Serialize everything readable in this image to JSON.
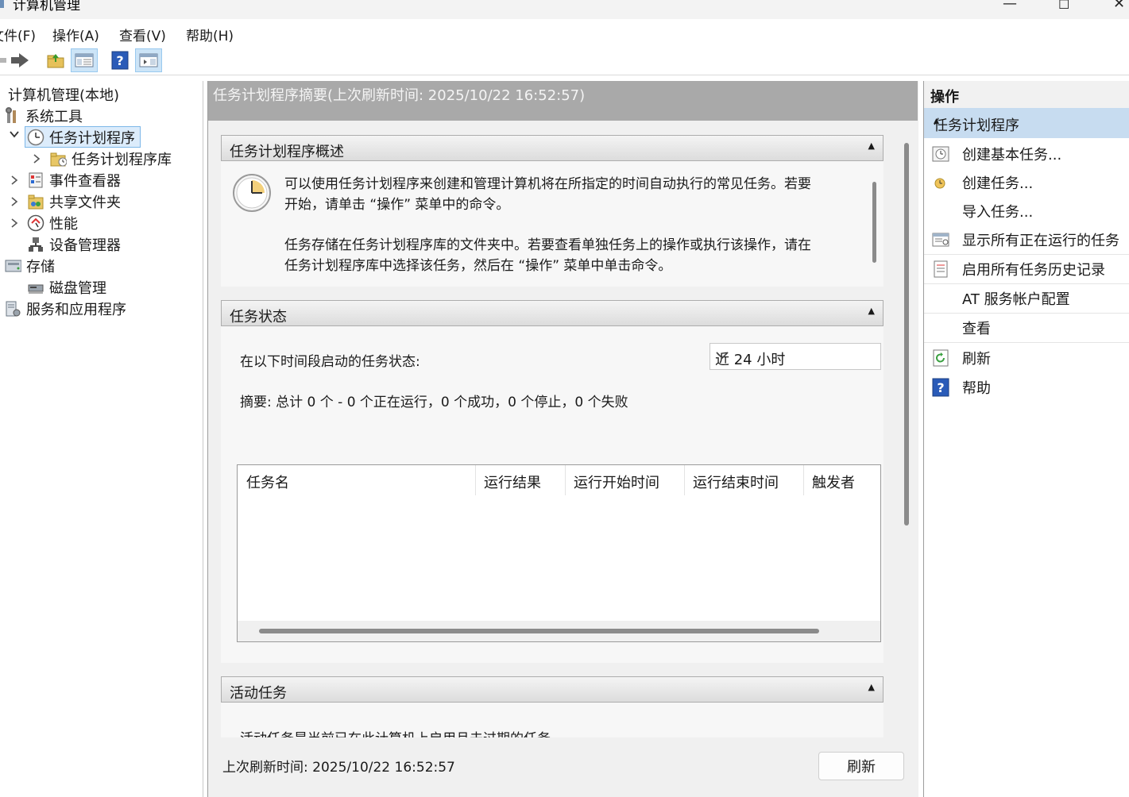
{
  "window": {
    "title": "计算机管理",
    "controls": {
      "minimize": "—",
      "maximize": "☐",
      "close": "✕"
    }
  },
  "menu": {
    "items": [
      "文件(F)",
      "操作(A)",
      "查看(V)",
      "帮助(H)"
    ]
  },
  "toolbar": {
    "buttons": [
      "back-arrow-icon",
      "forward-arrow-icon",
      "up-folder-icon",
      "show-hide-console-tree-icon",
      "help-icon",
      "show-hide-action-pane-icon"
    ]
  },
  "tree": {
    "items": [
      {
        "label": "计算机管理(本地)",
        "icon": "computer-icon"
      },
      {
        "label": "系统工具",
        "icon": "tools-icon"
      },
      {
        "label": "任务计划程序",
        "icon": "clock-icon",
        "selected": true
      },
      {
        "label": "任务计划程序库",
        "icon": "folder-clock-icon"
      },
      {
        "label": "事件查看器",
        "icon": "event-viewer-icon"
      },
      {
        "label": "共享文件夹",
        "icon": "shared-folder-icon"
      },
      {
        "label": "性能",
        "icon": "performance-icon"
      },
      {
        "label": "设备管理器",
        "icon": "device-manager-icon"
      },
      {
        "label": "存储",
        "icon": "storage-icon"
      },
      {
        "label": "磁盘管理",
        "icon": "disk-icon"
      },
      {
        "label": "服务和应用程序",
        "icon": "services-icon"
      }
    ]
  },
  "center": {
    "header": "任务计划程序摘要(上次刷新时间: 2025/10/22 16:52:57)",
    "overview": {
      "title": "任务计划程序概述",
      "para1_line1": "可以使用任务计划程序来创建和管理计算机将在所指定的时间自动执行的常见任务。若要",
      "para1_line2": "开始，请单击 “操作” 菜单中的命令。",
      "para2_line1": "任务存储在任务计划程序库的文件夹中。若要查看单独任务上的操作或执行该操作，请在",
      "para2_line2": "任务计划程序库中选择该任务，然后在 “操作” 菜单中单击命令。"
    },
    "status": {
      "title": "任务状态",
      "period_label": "在以下时间段启动的任务状态:",
      "period_value": "近 24 小时",
      "summary": "摘要: 总计 0 个 - 0 个正在运行，0 个成功，0 个停止，0 个失败",
      "columns": [
        "任务名",
        "运行结果",
        "运行开始时间",
        "运行结束时间",
        "触发者"
      ]
    },
    "active": {
      "title": "活动任务",
      "partial_text": "活动任务是当前已在此计算机上启用且未过期的任务。"
    },
    "last_refresh": "上次刷新时间: 2025/10/22 16:52:57",
    "refresh_button": "刷新"
  },
  "actions": {
    "header": "操作",
    "section": "任务计划程序",
    "items": [
      {
        "label": "创建基本任务...",
        "icon": "create-basic-task-icon"
      },
      {
        "label": "创建任务...",
        "icon": "create-task-icon"
      },
      {
        "label": "导入任务...",
        "icon": ""
      },
      {
        "label": "显示所有正在运行的任务",
        "icon": "running-tasks-icon"
      },
      {
        "label": "启用所有任务历史记录",
        "icon": "history-icon"
      },
      {
        "label": "AT 服务帐户配置",
        "icon": ""
      },
      {
        "label": "查看",
        "icon": ""
      },
      {
        "label": "刷新",
        "icon": "refresh-icon"
      },
      {
        "label": "帮助",
        "icon": "help-icon"
      }
    ]
  }
}
